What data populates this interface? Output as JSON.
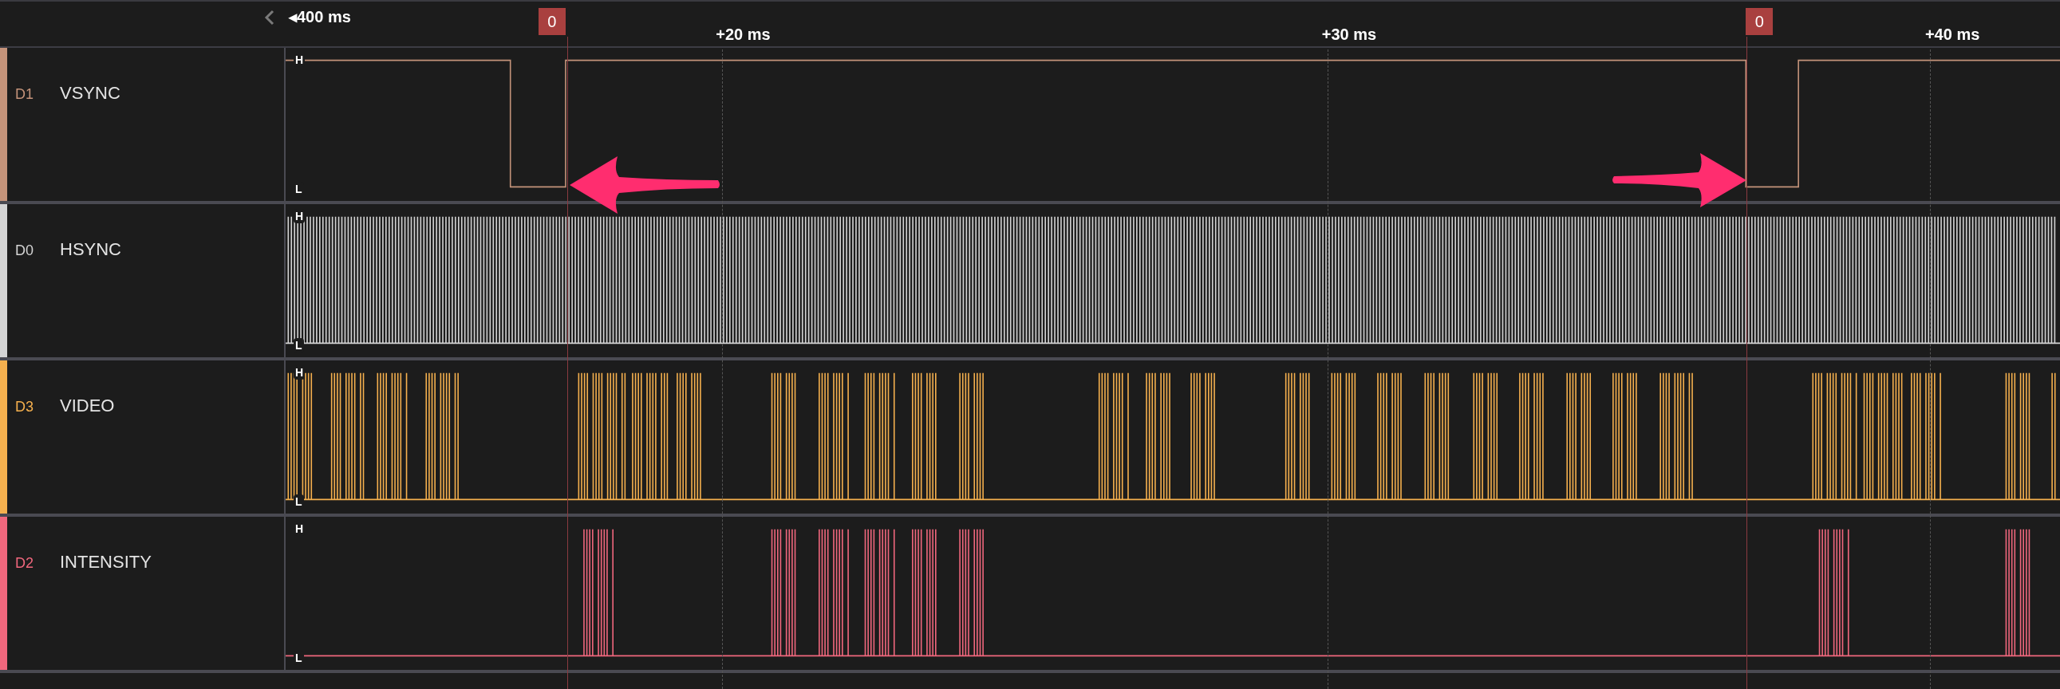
{
  "timeline": {
    "start_label": "◂400 ms",
    "ticks": [
      "+20 ms",
      "+30 ms",
      "+40 ms"
    ],
    "markers": [
      "0",
      "0"
    ]
  },
  "channels": [
    {
      "id": "D1",
      "name": "VSYNC",
      "color": "#c4937a",
      "high_label": "H",
      "low_label": "L"
    },
    {
      "id": "D0",
      "name": "HSYNC",
      "color": "#d4d4d4",
      "high_label": "H",
      "low_label": "L"
    },
    {
      "id": "D3",
      "name": "VIDEO",
      "color": "#f5b04e",
      "high_label": "H",
      "low_label": "L"
    },
    {
      "id": "D2",
      "name": "INTENSITY",
      "color": "#f0677d",
      "high_label": "H",
      "low_label": "L"
    }
  ]
}
